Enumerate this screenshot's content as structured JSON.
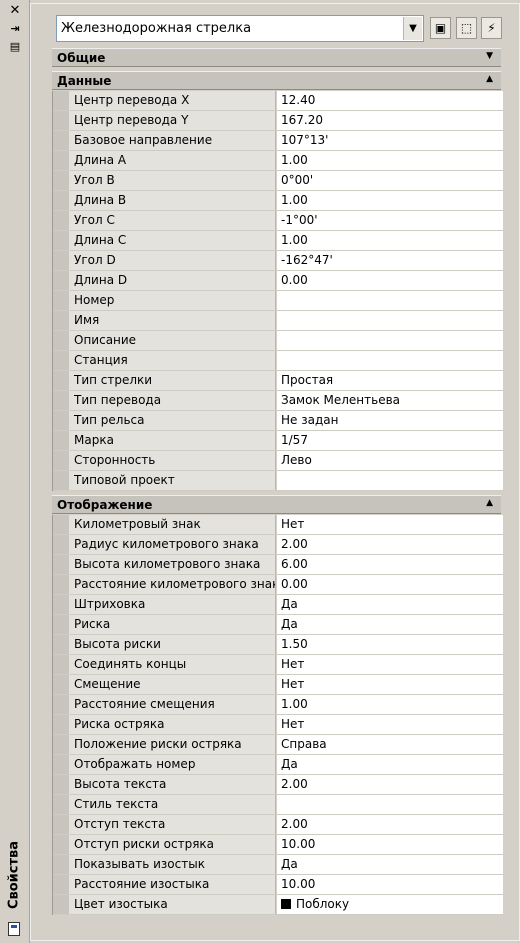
{
  "window": {
    "title": "Свойства"
  },
  "selector": {
    "value": "Железнодорожная стрелка"
  },
  "sections": {
    "general": "Общие",
    "data": "Данные",
    "display": "Отображение"
  },
  "data_rows": [
    {
      "name": "Центр перевода X",
      "value": "12.40"
    },
    {
      "name": "Центр перевода Y",
      "value": "167.20"
    },
    {
      "name": "Базовое направление",
      "value": "107°13'"
    },
    {
      "name": "Длина A",
      "value": "1.00"
    },
    {
      "name": "Угол B",
      "value": "0°00'"
    },
    {
      "name": "Длина B",
      "value": "1.00"
    },
    {
      "name": "Угол C",
      "value": "-1°00'"
    },
    {
      "name": "Длина C",
      "value": "1.00"
    },
    {
      "name": "Угол D",
      "value": "-162°47'"
    },
    {
      "name": "Длина D",
      "value": "0.00"
    },
    {
      "name": "Номер",
      "value": ""
    },
    {
      "name": "Имя",
      "value": ""
    },
    {
      "name": "Описание",
      "value": ""
    },
    {
      "name": "Станция",
      "value": ""
    },
    {
      "name": "Тип стрелки",
      "value": "Простая"
    },
    {
      "name": "Тип перевода",
      "value": "Замок Мелентьева"
    },
    {
      "name": "Тип рельса",
      "value": "Не задан"
    },
    {
      "name": "Марка",
      "value": "1/57"
    },
    {
      "name": "Сторонность",
      "value": "Лево"
    },
    {
      "name": "Типовой проект",
      "value": ""
    }
  ],
  "display_rows": [
    {
      "name": "Километровый знак",
      "value": "Нет"
    },
    {
      "name": "Радиус километрового знака",
      "value": "2.00"
    },
    {
      "name": "Высота километрового знака",
      "value": "6.00"
    },
    {
      "name": "Расстояние километрового знака",
      "value": "0.00"
    },
    {
      "name": "Штриховка",
      "value": "Да"
    },
    {
      "name": "Риска",
      "value": "Да"
    },
    {
      "name": "Высота риски",
      "value": "1.50"
    },
    {
      "name": "Соединять концы",
      "value": "Нет"
    },
    {
      "name": "Смещение",
      "value": "Нет"
    },
    {
      "name": "Расстояние смещения",
      "value": "1.00"
    },
    {
      "name": "Риска остряка",
      "value": "Нет"
    },
    {
      "name": "Положение риски остряка",
      "value": "Справа"
    },
    {
      "name": "Отображать номер",
      "value": "Да"
    },
    {
      "name": "Высота текста",
      "value": "2.00"
    },
    {
      "name": "Стиль текста",
      "value": ""
    },
    {
      "name": "Отступ текста",
      "value": "2.00"
    },
    {
      "name": "Отступ риски остряка",
      "value": "10.00"
    },
    {
      "name": "Показывать изостык",
      "value": "Да"
    },
    {
      "name": "Расстояние изостыка",
      "value": "10.00"
    },
    {
      "name": "Цвет изостыка",
      "value": "Поблоку",
      "swatch_color": "#000000"
    }
  ],
  "icons": {
    "close": "close-icon",
    "autohide": "autohide-icon",
    "menu": "properties-menu-icon",
    "dropdown": "chevron-down-icon",
    "toggle_pickadd": "pickadd-icon",
    "select_objects": "select-objects-icon",
    "quick_select": "quick-select-icon",
    "collapse": "collapse-arrow-icon",
    "expand": "expand-arrow-icon"
  }
}
